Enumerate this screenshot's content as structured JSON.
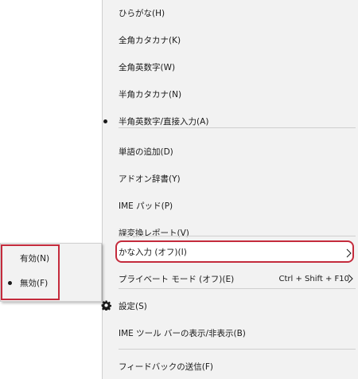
{
  "main_menu": {
    "items": [
      {
        "label": "ひらがな(H)"
      },
      {
        "label": "全角カタカナ(K)"
      },
      {
        "label": "全角英数字(W)"
      },
      {
        "label": "半角カタカナ(N)"
      },
      {
        "label": "半角英数字/直接入力(A)",
        "selected": true
      },
      {
        "label": "単語の追加(D)"
      },
      {
        "label": "アドオン辞書(Y)"
      },
      {
        "label": "IME パッド(P)"
      },
      {
        "label": "誤変換レポート(V)"
      },
      {
        "label": "かな入力 (オフ)(I)",
        "has_submenu": true
      },
      {
        "label": "プライベート モード (オフ)(E)",
        "shortcut": "Ctrl + Shift + F10",
        "has_submenu": true
      },
      {
        "label": "設定(S)",
        "icon": "gear-icon"
      },
      {
        "label": "IME ツール バーの表示/非表示(B)"
      },
      {
        "label": "フィードバックの送信(F)"
      }
    ]
  },
  "sub_menu": {
    "items": [
      {
        "label": "有効(N)"
      },
      {
        "label": "無効(F)",
        "selected": true
      }
    ]
  },
  "colors": {
    "menu_background": "#f2f2f2",
    "highlight_border": "#c42b3c",
    "separator": "#cfcfcf",
    "text": "#1a1a1a"
  }
}
